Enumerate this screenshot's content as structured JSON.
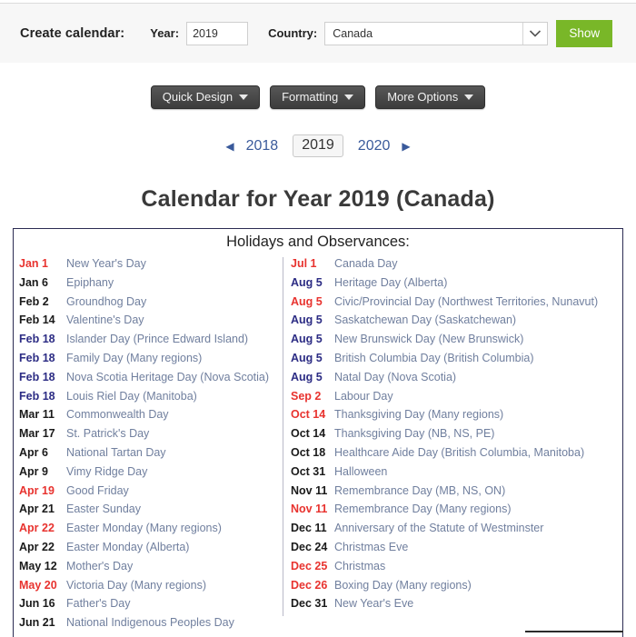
{
  "toolbar": {
    "create_label": "Create calendar:",
    "year_label": "Year:",
    "year_value": "2019",
    "country_label": "Country:",
    "country_value": "Canada",
    "show_label": "Show",
    "select_arrow_icon": "chevron-down-icon",
    "show_button_color": "#79b728"
  },
  "menus": [
    {
      "label": "Quick Design",
      "icon": "caret-down-icon"
    },
    {
      "label": "Formatting",
      "icon": "caret-down-icon"
    },
    {
      "label": "More Options",
      "icon": "caret-down-icon"
    }
  ],
  "year_nav": {
    "prev_arrow_icon": "triangle-left-icon",
    "next_arrow_icon": "triangle-right-icon",
    "prev_year": "2018",
    "current_year": "2019",
    "next_year": "2020",
    "link_color": "#3a5a9b"
  },
  "page_title": "Calendar for Year 2019 (Canada)",
  "holidays": {
    "heading": "Holidays and Observances:",
    "date_colors": {
      "holiday": "#e8332f",
      "regional": "#2c2c84",
      "observance": "#1a1a1a",
      "name": "#707f9e"
    },
    "left_column": [
      {
        "date": "Jan 1",
        "name": "New Year's Day",
        "color": "red"
      },
      {
        "date": "Jan 6",
        "name": "Epiphany",
        "color": "dark"
      },
      {
        "date": "Feb 2",
        "name": "Groundhog Day",
        "color": "dark"
      },
      {
        "date": "Feb 14",
        "name": "Valentine's Day",
        "color": "dark"
      },
      {
        "date": "Feb 18",
        "name": "Islander Day (Prince Edward Island)",
        "color": "navy"
      },
      {
        "date": "Feb 18",
        "name": "Family Day (Many regions)",
        "color": "navy"
      },
      {
        "date": "Feb 18",
        "name": "Nova Scotia Heritage Day (Nova Scotia)",
        "color": "navy"
      },
      {
        "date": "Feb 18",
        "name": "Louis Riel Day (Manitoba)",
        "color": "navy"
      },
      {
        "date": "Mar 11",
        "name": "Commonwealth Day",
        "color": "dark"
      },
      {
        "date": "Mar 17",
        "name": "St. Patrick's Day",
        "color": "dark"
      },
      {
        "date": "Apr 6",
        "name": "National Tartan Day",
        "color": "dark"
      },
      {
        "date": "Apr 9",
        "name": "Vimy Ridge Day",
        "color": "dark"
      },
      {
        "date": "Apr 19",
        "name": "Good Friday",
        "color": "red"
      },
      {
        "date": "Apr 21",
        "name": "Easter Sunday",
        "color": "dark"
      },
      {
        "date": "Apr 22",
        "name": "Easter Monday (Many regions)",
        "color": "red"
      },
      {
        "date": "Apr 22",
        "name": "Easter Monday (Alberta)",
        "color": "dark"
      },
      {
        "date": "May 12",
        "name": "Mother's Day",
        "color": "dark"
      },
      {
        "date": "May 20",
        "name": "Victoria Day (Many regions)",
        "color": "red"
      },
      {
        "date": "Jun 16",
        "name": "Father's Day",
        "color": "dark"
      },
      {
        "date": "Jun 21",
        "name": "National Indigenous Peoples Day",
        "color": "dark"
      }
    ],
    "right_column": [
      {
        "date": "Jul 1",
        "name": "Canada Day",
        "color": "red"
      },
      {
        "date": "Aug 5",
        "name": "Heritage Day (Alberta)",
        "color": "navy"
      },
      {
        "date": "Aug 5",
        "name": "Civic/Provincial Day (Northwest Territories, Nunavut)",
        "color": "red"
      },
      {
        "date": "Aug 5",
        "name": "Saskatchewan Day (Saskatchewan)",
        "color": "navy"
      },
      {
        "date": "Aug 5",
        "name": "New Brunswick Day (New Brunswick)",
        "color": "navy"
      },
      {
        "date": "Aug 5",
        "name": "British Columbia Day (British Columbia)",
        "color": "navy"
      },
      {
        "date": "Aug 5",
        "name": "Natal Day (Nova Scotia)",
        "color": "navy"
      },
      {
        "date": "Sep 2",
        "name": "Labour Day",
        "color": "red"
      },
      {
        "date": "Oct 14",
        "name": "Thanksgiving Day (Many regions)",
        "color": "red"
      },
      {
        "date": "Oct 14",
        "name": "Thanksgiving Day (NB, NS, PE)",
        "color": "dark"
      },
      {
        "date": "Oct 18",
        "name": "Healthcare Aide Day (British Columbia, Manitoba)",
        "color": "dark"
      },
      {
        "date": "Oct 31",
        "name": "Halloween",
        "color": "dark"
      },
      {
        "date": "Nov 11",
        "name": "Remembrance Day (MB, NS, ON)",
        "color": "dark"
      },
      {
        "date": "Nov 11",
        "name": "Remembrance Day (Many regions)",
        "color": "red"
      },
      {
        "date": "Dec 11",
        "name": "Anniversary of the Statute of Westminster",
        "color": "dark"
      },
      {
        "date": "Dec 24",
        "name": "Christmas Eve",
        "color": "dark"
      },
      {
        "date": "Dec 25",
        "name": "Christmas",
        "color": "red"
      },
      {
        "date": "Dec 26",
        "name": "Boxing Day (Many regions)",
        "color": "red"
      },
      {
        "date": "Dec 31",
        "name": "New Year's Eve",
        "color": "dark"
      }
    ]
  }
}
